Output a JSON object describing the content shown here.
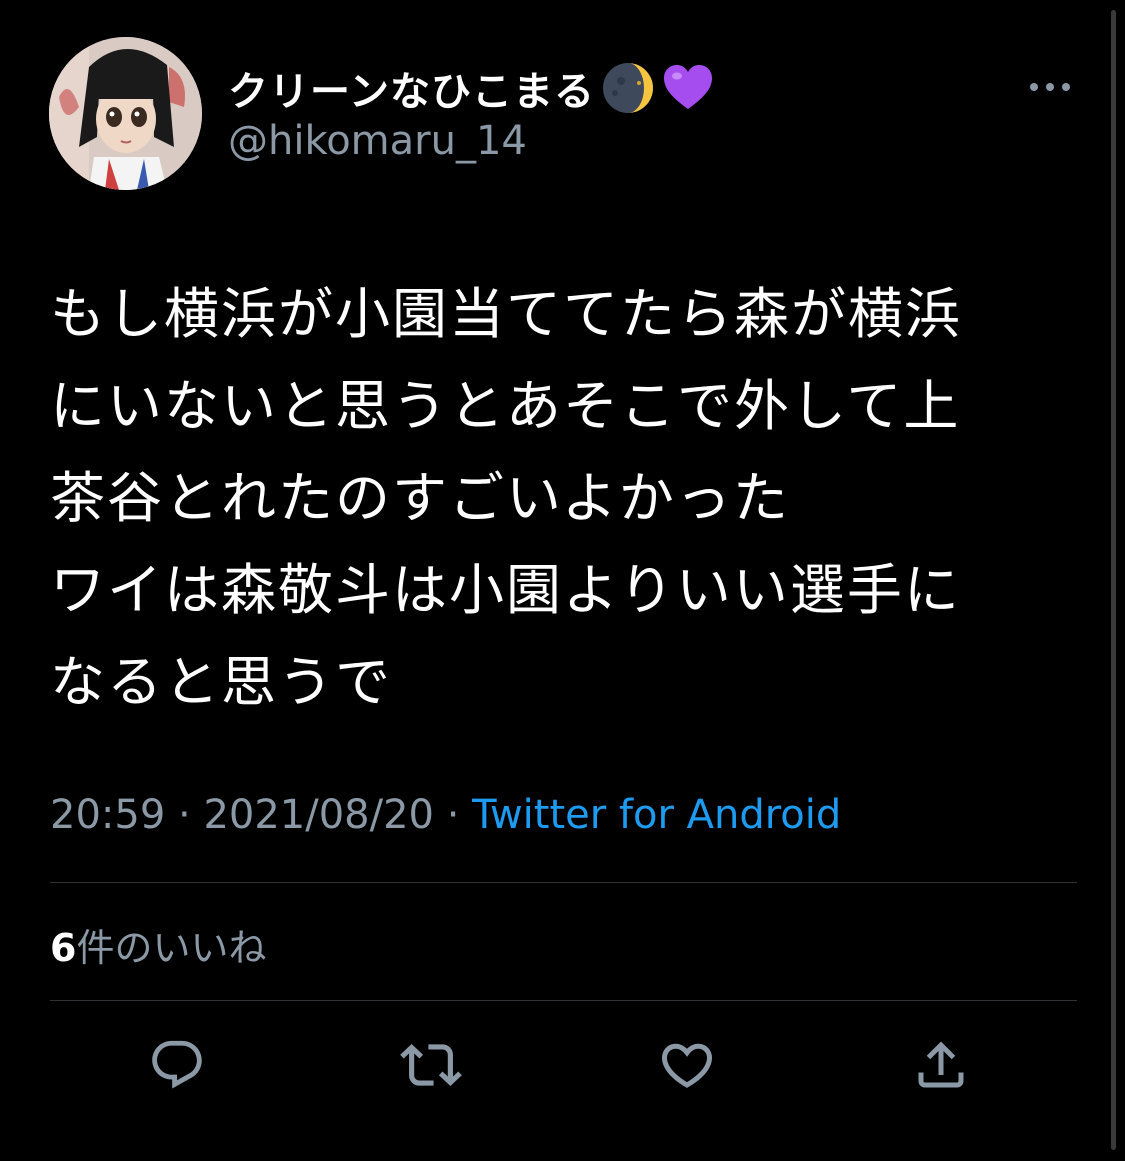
{
  "tweet": {
    "display_name": "クリーンなひこまる",
    "emoji_1": "waning-crescent-moon-icon",
    "emoji_2": "purple-heart-icon",
    "handle": "@hikomaru_14",
    "text_lines": [
      "もし横浜が小園当ててたら森が横浜",
      "にいないと思うとあそこで外して上",
      "茶谷とれたのすごいよかった",
      "ワイは森敬斗は小園よりいい選手に",
      "なると思うで"
    ],
    "time": "20:59",
    "separator": "·",
    "date": "2021/08/20",
    "source": "Twitter for Android"
  },
  "likes": {
    "count": "6",
    "label": "件のいいね"
  },
  "actions": {
    "reply_icon": "reply-icon",
    "retweet_icon": "retweet-icon",
    "like_icon": "heart-icon",
    "share_icon": "share-icon"
  },
  "colors": {
    "background": "#000000",
    "text": "#ffffff",
    "secondary": "#8b98a5",
    "link": "#1d9bf0",
    "divider": "#2f3336"
  }
}
